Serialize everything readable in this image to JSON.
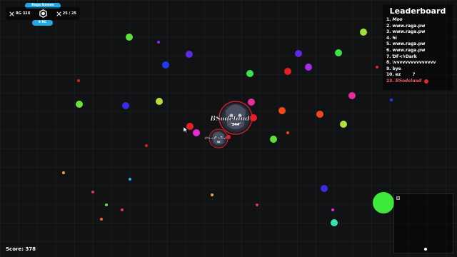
{
  "server": {
    "game_name": "Raga Games",
    "region_label": "9 RC",
    "mode_label": "RG 32X",
    "players_label": "25 / 25"
  },
  "leaderboard": {
    "title": "Leaderboard",
    "entries": [
      {
        "rank": "1.",
        "name": "Moo"
      },
      {
        "rank": "2.",
        "name": "www.raga.pw"
      },
      {
        "rank": "3.",
        "name": "www.raga.pw"
      },
      {
        "rank": "4.",
        "name": "hi"
      },
      {
        "rank": "5.",
        "name": "www.raga.pw"
      },
      {
        "rank": "6.",
        "name": "www.raga.pw"
      },
      {
        "rank": "7.",
        "name": "ƊҒ≺ϟDark"
      },
      {
        "rank": "8.",
        "name": "\\vvvvvvvvvvvvvvv"
      },
      {
        "rank": "9.",
        "name": "bye"
      },
      {
        "rank": "10.",
        "name": "ez        ?"
      }
    ],
    "me": {
      "rank": "23.",
      "name": "BSodeluud",
      "color": "#e8202a"
    }
  },
  "player": {
    "name": "BSodeluud",
    "big_mass": "244",
    "small_mass": "56",
    "color": "#e8202a"
  },
  "score": {
    "label": "Score:",
    "value": "378"
  },
  "colors": {
    "background": "#111214",
    "accent": "#29a8e0",
    "player_ring": "#e8202a"
  },
  "minimap": {
    "player_marker": "white-dot"
  }
}
